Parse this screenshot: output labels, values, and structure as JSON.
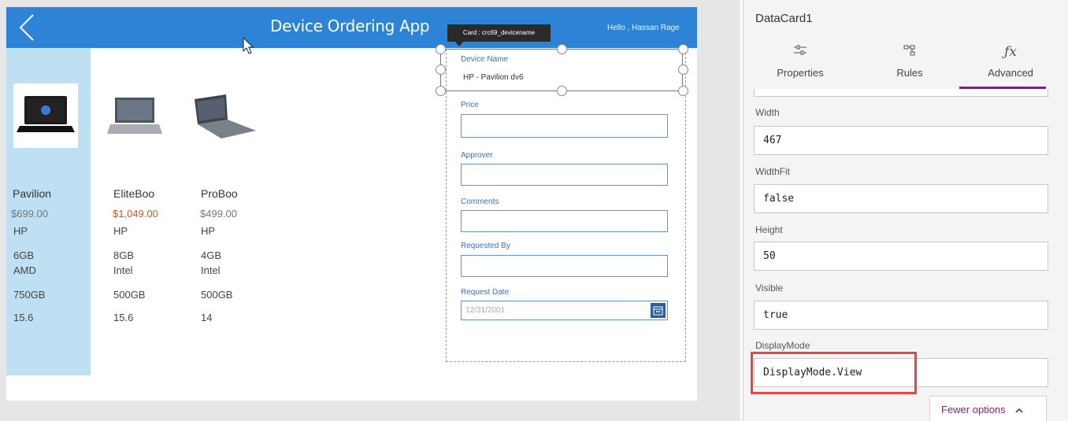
{
  "app": {
    "title": "Device Ordering App",
    "greeting": "Hello , Hassan Rage"
  },
  "products": [
    {
      "name": "Pavilion",
      "price": "$699.00",
      "brand": "HP",
      "ram": "6GB",
      "cpu": "AMD",
      "storage": "750GB",
      "screen": "15.6"
    },
    {
      "name": "EliteBoo",
      "price": "$1,049.00",
      "brand": "HP",
      "ram": "8GB",
      "cpu": "Intel",
      "storage": "500GB",
      "screen": "15.6"
    },
    {
      "name": "ProBoo",
      "price": "$499.00",
      "brand": "HP",
      "ram": "4GB",
      "cpu": "Intel",
      "storage": "500GB",
      "screen": "14"
    }
  ],
  "form": {
    "tooltip": "Card : crc69_devicename",
    "device_name_label": "Device Name",
    "device_name_value": "HP - Pavilion dv6",
    "price_label": "Price",
    "approver_label": "Approver",
    "comments_label": "Comments",
    "requested_by_label": "Requested By",
    "request_date_label": "Request Date",
    "request_date_placeholder": "12/31/2001"
  },
  "panel": {
    "card_name": "DataCard1",
    "tabs": [
      {
        "label": "Properties",
        "icon": "sliders-icon"
      },
      {
        "label": "Rules",
        "icon": "rules-icon"
      },
      {
        "label": "Advanced",
        "icon": "fx-icon"
      }
    ],
    "props": [
      {
        "label": "Width",
        "value": "467"
      },
      {
        "label": "WidthFit",
        "value": "false"
      },
      {
        "label": "Height",
        "value": "50"
      },
      {
        "label": "Visible",
        "value": "true"
      },
      {
        "label": "DisplayMode",
        "value": "DisplayMode.View"
      }
    ],
    "fewer_options": "Fewer options"
  },
  "colors": {
    "header_blue": "#2d84d6",
    "gallery_selected": "#bfe0f3",
    "accent_purple": "#742774",
    "highlight_red": "#e04848",
    "price_red": "#e0521d"
  }
}
